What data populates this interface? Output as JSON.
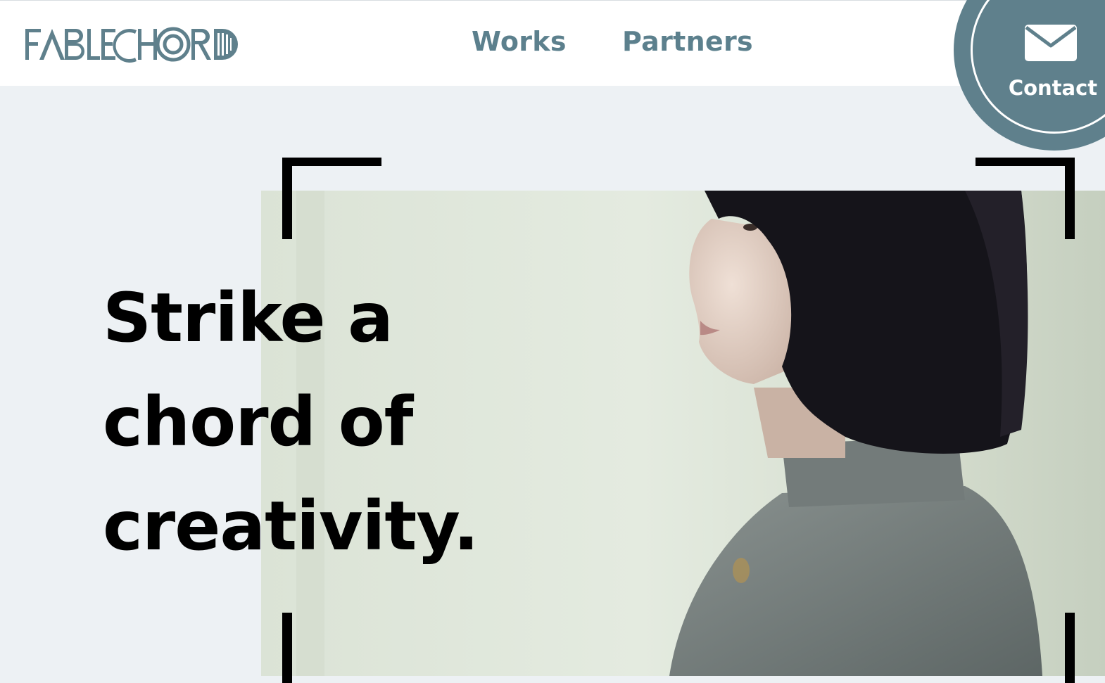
{
  "header": {
    "logo_text": "FABLECHORD",
    "nav": [
      {
        "label": "Works"
      },
      {
        "label": "Partners"
      }
    ],
    "contact": {
      "label": "Contact",
      "icon": "envelope-icon"
    }
  },
  "hero": {
    "headline_lines": [
      "Strike a",
      "chord of",
      "creativity."
    ],
    "image_description_icon": "photo"
  },
  "colors": {
    "brand": "#5f808c",
    "nav_text": "#5c808d",
    "page_bg": "#edf1f4",
    "header_bg": "#ffffff",
    "headline": "#000000"
  }
}
